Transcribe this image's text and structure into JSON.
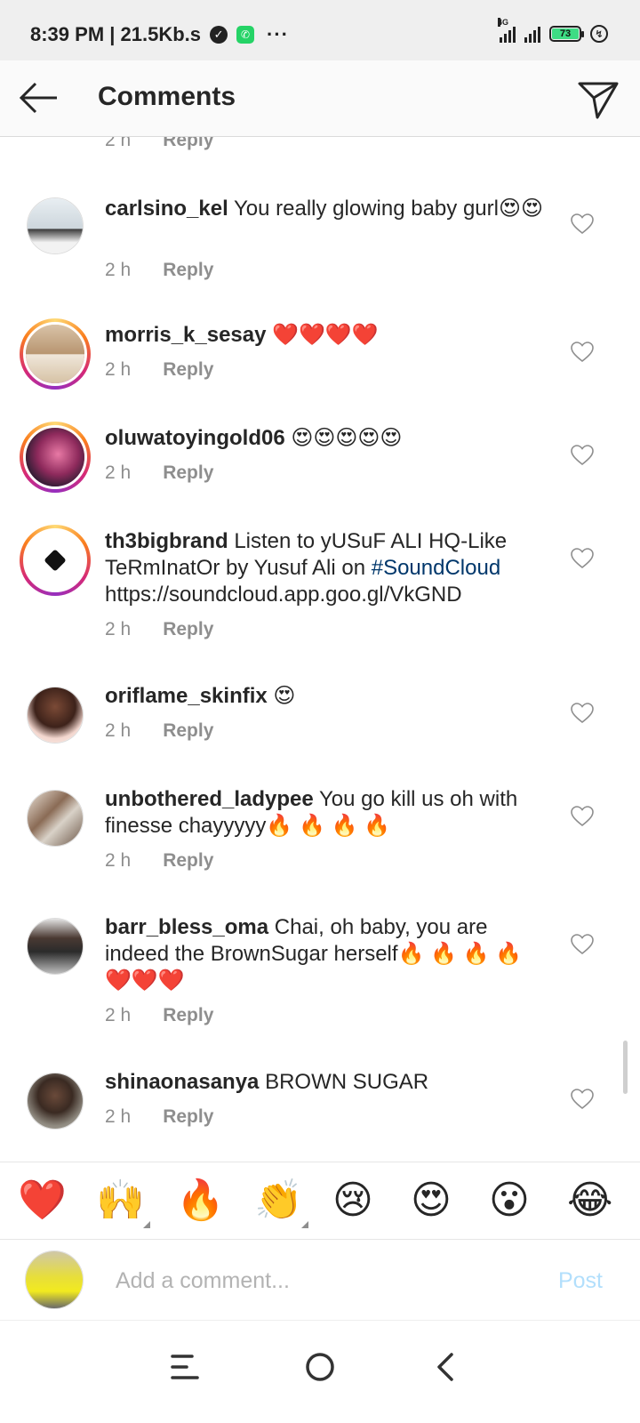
{
  "status_bar": {
    "time_and_speed": "8:39 PM | 21.5Kb.s",
    "more": "···",
    "network": "4G",
    "battery_level": "73"
  },
  "header": {
    "title": "Comments"
  },
  "comments": [
    {
      "user": "",
      "text": "",
      "time": "2 h",
      "reply": "Reply"
    },
    {
      "user": "carlsino_kel",
      "text": " You really glowing baby gurl😍😍",
      "time": "2 h",
      "reply": "Reply"
    },
    {
      "user": "morris_k_sesay",
      "text": " ❤️❤️❤️❤️",
      "time": "2 h",
      "reply": "Reply"
    },
    {
      "user": "oluwatoyingold06",
      "text": " 😍😍😍😍😍",
      "time": "2 h",
      "reply": "Reply"
    },
    {
      "user": "th3bigbrand",
      "text_before": " Listen to yUSuF ALI HQ-Like TeRmInatOr by Yusuf Ali on ",
      "hashtag": "#SoundCloud",
      "text_after": " https://soundcloud.app.goo.gl/VkGND",
      "time": "2 h",
      "reply": "Reply"
    },
    {
      "user": "oriflame_skinfix",
      "text": " 😍",
      "time": "2 h",
      "reply": "Reply"
    },
    {
      "user": "unbothered_ladypee",
      "text": " You go  kill us oh with finesse chayyyyy🔥 🔥 🔥 🔥",
      "time": "2 h",
      "reply": "Reply"
    },
    {
      "user": "barr_bless_oma",
      "text": " Chai, oh baby, you are indeed the BrownSugar herself🔥 🔥 🔥 🔥 ❤️❤️❤️",
      "time": "2 h",
      "reply": "Reply"
    },
    {
      "user": "shinaonasanya",
      "text": " BROWN SUGAR",
      "time": "2 h",
      "reply": "Reply"
    }
  ],
  "emoji_bar": [
    "❤️",
    "🙌",
    "🔥",
    "👏",
    "😢",
    "😍",
    "😮",
    "😂"
  ],
  "composer": {
    "placeholder": "Add a comment...",
    "post_label": "Post"
  },
  "colors": {
    "link": "#00376b",
    "meta": "#8e8e8e",
    "post_disabled": "#b2dffc"
  }
}
